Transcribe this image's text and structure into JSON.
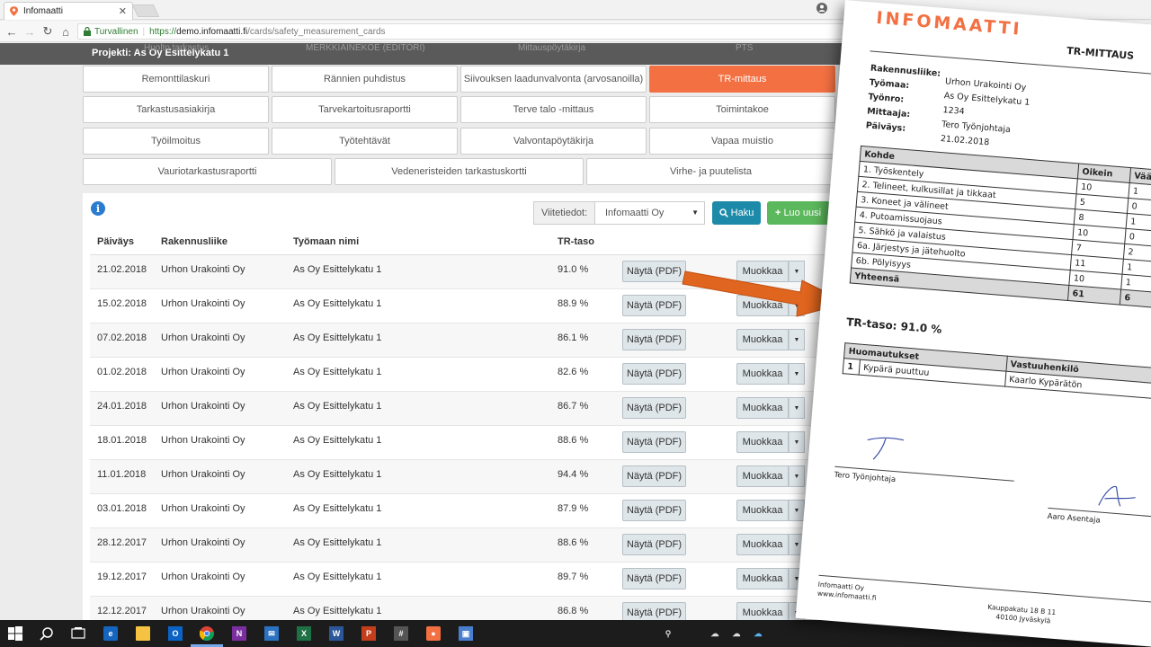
{
  "browser": {
    "tab_title": "Infomaatti",
    "secure_label": "Turvallinen",
    "url_scheme": "https://",
    "url_host": "demo.infomaatti.fi",
    "url_path": "/cards/safety_measurement_cards"
  },
  "page": {
    "project_title": "Projekti: As Oy Esittelykatu 1",
    "hidden_tabs": [
      "Huolto tarkastus",
      "MERKKIAINEKOE (EDITORI)",
      "Mittauspöytäkirja",
      "PTS"
    ],
    "card_buttons_row1": [
      "Remonttilaskuri",
      "Rännien puhdistus",
      "Siivouksen laadunvalvonta (arvosanoilla)",
      "TR-mittaus"
    ],
    "card_buttons_row2": [
      "Tarkastusasiakirja",
      "Tarvekartoitusraportti",
      "Terve talo -mittaus",
      "Toimintakoe"
    ],
    "card_buttons_row3": [
      "Työilmoitus",
      "Työtehtävät",
      "Valvontapöytäkirja",
      "Vapaa muistio"
    ],
    "card_buttons_row4": [
      "Vauriotarkastusraportti",
      "Vedeneristeiden tarkastuskortti",
      "Virhe- ja puutelista"
    ],
    "active_card": "TR-mittaus",
    "filter": {
      "label": "Viitetiedot:",
      "selected": "Infomaatti Oy",
      "search_label": "Haku",
      "new_label": "Luo uusi"
    },
    "table": {
      "headers": [
        "Päiväys",
        "Rakennusliike",
        "Työmaan nimi",
        "TR-taso"
      ],
      "view_label": "Näytä (PDF)",
      "edit_label": "Muokkaa",
      "rows": [
        {
          "date": "21.02.2018",
          "company": "Urhon Urakointi Oy",
          "site": "As Oy Esittelykatu 1",
          "level": "91.0 %"
        },
        {
          "date": "15.02.2018",
          "company": "Urhon Urakointi Oy",
          "site": "As Oy Esittelykatu 1",
          "level": "88.9 %"
        },
        {
          "date": "07.02.2018",
          "company": "Urhon Urakointi Oy",
          "site": "As Oy Esittelykatu 1",
          "level": "86.1 %"
        },
        {
          "date": "01.02.2018",
          "company": "Urhon Urakointi Oy",
          "site": "As Oy Esittelykatu 1",
          "level": "82.6 %"
        },
        {
          "date": "24.01.2018",
          "company": "Urhon Urakointi Oy",
          "site": "As Oy Esittelykatu 1",
          "level": "86.7 %"
        },
        {
          "date": "18.01.2018",
          "company": "Urhon Urakointi Oy",
          "site": "As Oy Esittelykatu 1",
          "level": "88.6 %"
        },
        {
          "date": "11.01.2018",
          "company": "Urhon Urakointi Oy",
          "site": "As Oy Esittelykatu 1",
          "level": "94.4 %"
        },
        {
          "date": "03.01.2018",
          "company": "Urhon Urakointi Oy",
          "site": "As Oy Esittelykatu 1",
          "level": "87.9 %"
        },
        {
          "date": "28.12.2017",
          "company": "Urhon Urakointi Oy",
          "site": "As Oy Esittelykatu 1",
          "level": "88.6 %"
        },
        {
          "date": "19.12.2017",
          "company": "Urhon Urakointi Oy",
          "site": "As Oy Esittelykatu 1",
          "level": "89.7 %"
        },
        {
          "date": "12.12.2017",
          "company": "Urhon Urakointi Oy",
          "site": "As Oy Esittelykatu 1",
          "level": "86.8 %"
        }
      ]
    }
  },
  "document": {
    "logo": "INFOMAATTI",
    "title": "TR-MITTAUS",
    "meta": [
      {
        "label": "Rakennusliike:",
        "value": "Urhon Urakointi Oy"
      },
      {
        "label": "Työmaa:",
        "value": "As Oy Esittelykatu 1"
      },
      {
        "label": "Työnro:",
        "value": "1234"
      },
      {
        "label": "Mittaaja:",
        "value": "Tero Työnjohtaja"
      },
      {
        "label": "Päiväys:",
        "value": "21.02.2018"
      }
    ],
    "table": {
      "headers": [
        "Kohde",
        "Oikein",
        "Väärin"
      ],
      "rows": [
        {
          "item": "1. Työskentely",
          "ok": "10",
          "wrong": "1"
        },
        {
          "item": "2. Telineet, kulkusillat ja tikkaat",
          "ok": "5",
          "wrong": "0"
        },
        {
          "item": "3. Koneet ja välineet",
          "ok": "8",
          "wrong": "1"
        },
        {
          "item": "4. Putoamissuojaus",
          "ok": "10",
          "wrong": "0"
        },
        {
          "item": "5. Sähkö ja valaistus",
          "ok": "7",
          "wrong": "2"
        },
        {
          "item": "6a. Järjestys ja jätehuolto",
          "ok": "11",
          "wrong": "1"
        },
        {
          "item": "6b. Pölyisyys",
          "ok": "10",
          "wrong": "1"
        }
      ],
      "total_label": "Yhteensä",
      "total_ok": "61",
      "total_wrong": "6"
    },
    "tr_level": "TR-taso: 91.0 %",
    "remarks": {
      "headers": [
        "Huomautukset",
        "Vastuuhenkilö"
      ],
      "rows": [
        {
          "num": "1",
          "text": "Kypärä puuttuu",
          "person": "Kaarlo Kypärätön"
        }
      ]
    },
    "signatures": [
      "Tero Työnjohtaja",
      "Aaro Asentaja"
    ],
    "footer": {
      "company": "Infomaatti Oy",
      "website": "www.infomaatti.fi",
      "address1": "Kauppakatu 18 B 11",
      "address2": "40100 Jyväskylä"
    }
  },
  "colors": {
    "accent": "#f37042",
    "search_button": "#1c8aa8",
    "new_button": "#5cb85c",
    "project_bar": "#5a5a5a",
    "arrow": "#e0651e"
  }
}
